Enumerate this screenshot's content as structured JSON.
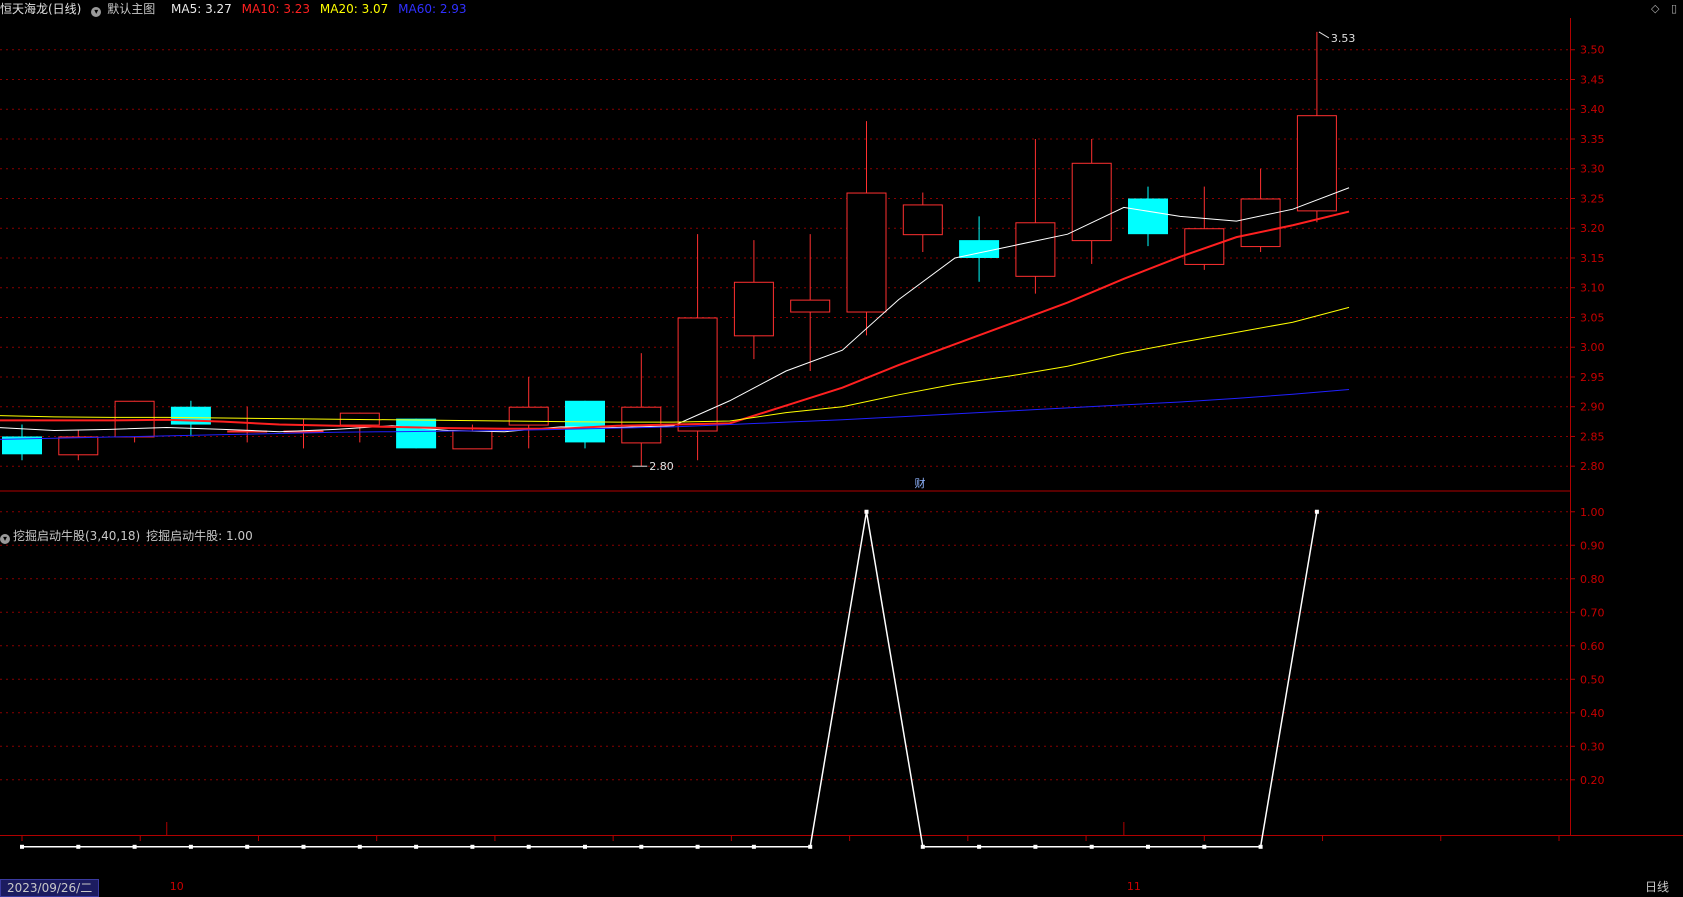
{
  "header": {
    "stock_name": "恒天海龙(日线)",
    "template_label": "默认主图",
    "ma5": "MA5: 3.27",
    "ma10": "MA10: 3.23",
    "ma20": "MA20: 3.07",
    "ma60": "MA60: 2.93",
    "colors": {
      "ma5": "#ffffff",
      "ma10": "#ff2020",
      "ma20": "#ffff00",
      "ma60": "#2020ff",
      "up": "#ff3030",
      "down": "#00ffff"
    }
  },
  "indicator": {
    "title": "挖掘启动牛股(3,40,18)",
    "value_label": "挖掘启动牛股: 1.00"
  },
  "footer": {
    "date": "2023/09/26/二",
    "period": "日线",
    "month_labels": [
      {
        "text": "10",
        "index": 3
      },
      {
        "text": "11",
        "index": 20
      }
    ]
  },
  "annotations": {
    "high_label": "3.53",
    "low_label": "2.80",
    "event_marker": "财"
  },
  "chart_data": [
    {
      "type": "candlestick",
      "title": "",
      "ylim": [
        2.76,
        3.55
      ],
      "y_ticks": [
        2.8,
        2.85,
        2.9,
        2.95,
        3.0,
        3.05,
        3.1,
        3.15,
        3.2,
        3.25,
        3.3,
        3.35,
        3.4,
        3.45,
        3.5
      ],
      "grid": true,
      "candles": [
        {
          "o": 2.85,
          "h": 2.87,
          "l": 2.81,
          "c": 2.82
        },
        {
          "o": 2.82,
          "h": 2.86,
          "l": 2.81,
          "c": 2.85
        },
        {
          "o": 2.85,
          "h": 2.91,
          "l": 2.84,
          "c": 2.91
        },
        {
          "o": 2.9,
          "h": 2.91,
          "l": 2.85,
          "c": 2.87
        },
        {
          "o": 2.86,
          "h": 2.9,
          "l": 2.84,
          "c": 2.86
        },
        {
          "o": 2.86,
          "h": 2.88,
          "l": 2.83,
          "c": 2.86
        },
        {
          "o": 2.87,
          "h": 2.89,
          "l": 2.84,
          "c": 2.89
        },
        {
          "o": 2.88,
          "h": 2.88,
          "l": 2.83,
          "c": 2.83
        },
        {
          "o": 2.83,
          "h": 2.87,
          "l": 2.83,
          "c": 2.86
        },
        {
          "o": 2.87,
          "h": 2.95,
          "l": 2.83,
          "c": 2.9
        },
        {
          "o": 2.91,
          "h": 2.91,
          "l": 2.83,
          "c": 2.84
        },
        {
          "o": 2.84,
          "h": 2.99,
          "l": 2.8,
          "c": 2.9
        },
        {
          "o": 2.86,
          "h": 3.19,
          "l": 2.81,
          "c": 3.05
        },
        {
          "o": 3.02,
          "h": 3.18,
          "l": 2.98,
          "c": 3.11
        },
        {
          "o": 3.06,
          "h": 3.19,
          "l": 2.96,
          "c": 3.08
        },
        {
          "o": 3.06,
          "h": 3.38,
          "l": 3.02,
          "c": 3.26
        },
        {
          "o": 3.19,
          "h": 3.26,
          "l": 3.16,
          "c": 3.24
        },
        {
          "o": 3.18,
          "h": 3.22,
          "l": 3.11,
          "c": 3.15
        },
        {
          "o": 3.12,
          "h": 3.35,
          "l": 3.09,
          "c": 3.21
        },
        {
          "o": 3.18,
          "h": 3.35,
          "l": 3.14,
          "c": 3.31
        },
        {
          "o": 3.25,
          "h": 3.27,
          "l": 3.17,
          "c": 3.19
        },
        {
          "o": 3.14,
          "h": 3.27,
          "l": 3.13,
          "c": 3.2
        },
        {
          "o": 3.17,
          "h": 3.3,
          "l": 3.16,
          "c": 3.25
        },
        {
          "o": 3.23,
          "h": 3.53,
          "l": 3.21,
          "c": 3.39
        }
      ],
      "series": [
        {
          "name": "MA5",
          "values": [
            2.865,
            2.86,
            2.862,
            2.865,
            2.862,
            2.858,
            2.862,
            2.868,
            2.86,
            2.858,
            2.866,
            2.865,
            2.868,
            2.91,
            2.96,
            2.995,
            3.08,
            3.15,
            3.17,
            3.19,
            3.235,
            3.22,
            3.212,
            3.232,
            3.268
          ]
        },
        {
          "name": "MA10",
          "values": [
            2.877,
            2.877,
            2.877,
            2.878,
            2.875,
            2.87,
            2.868,
            2.866,
            2.864,
            2.863,
            2.863,
            2.868,
            2.87,
            2.872,
            2.902,
            2.932,
            2.97,
            3.005,
            3.04,
            3.075,
            3.115,
            3.152,
            3.185,
            3.205,
            3.228
          ]
        },
        {
          "name": "MA20",
          "values": [
            2.885,
            2.883,
            2.882,
            2.882,
            2.881,
            2.88,
            2.879,
            2.878,
            2.877,
            2.876,
            2.875,
            2.874,
            2.874,
            2.876,
            2.89,
            2.9,
            2.92,
            2.938,
            2.952,
            2.968,
            2.99,
            3.008,
            3.025,
            3.042,
            3.067
          ]
        },
        {
          "name": "MA60",
          "values": [
            2.845,
            2.847,
            2.849,
            2.851,
            2.853,
            2.855,
            2.857,
            2.858,
            2.859,
            2.86,
            2.862,
            2.864,
            2.866,
            2.87,
            2.874,
            2.878,
            2.883,
            2.888,
            2.893,
            2.898,
            2.903,
            2.908,
            2.914,
            2.921,
            2.929
          ]
        }
      ]
    },
    {
      "type": "line",
      "title": "",
      "ylim": [
        0.08,
        1.05
      ],
      "y_ticks": [
        0.2,
        0.3,
        0.4,
        0.5,
        0.6,
        0.7,
        0.8,
        0.9,
        1.0
      ],
      "grid": true,
      "series": [
        {
          "name": "挖掘启动牛股",
          "values": [
            0,
            0,
            0,
            0,
            0,
            0,
            0,
            0,
            0,
            0,
            0,
            0,
            0,
            0,
            0,
            1,
            0,
            0,
            0,
            0,
            0,
            0,
            0,
            1
          ]
        }
      ]
    }
  ]
}
